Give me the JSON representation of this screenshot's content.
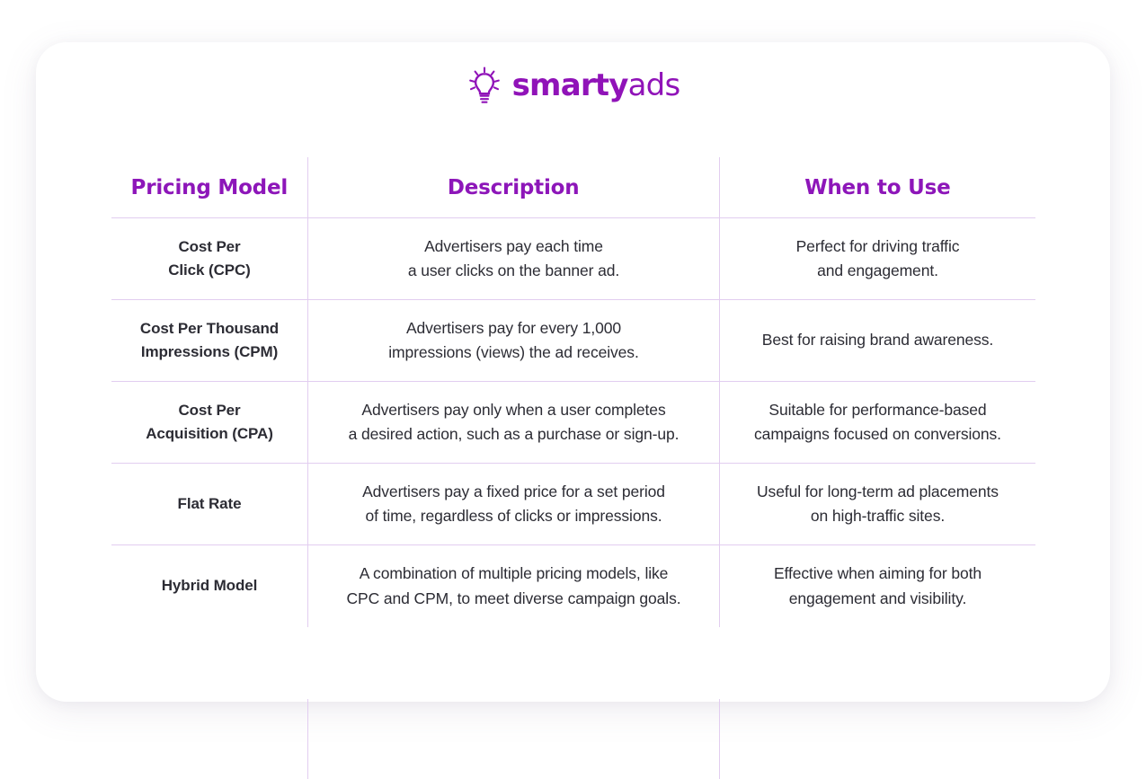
{
  "brand": {
    "name_bold": "smarty",
    "name_light": "ads",
    "logo_icon": "lightbulb-icon",
    "color": "#9013b8"
  },
  "table": {
    "accent_color": "#8d16b9",
    "divider_color": "#e2cdf0",
    "headers": [
      "Pricing Model",
      "Description",
      "When to Use"
    ],
    "rows": [
      {
        "model": [
          "Cost Per",
          "Click (CPC)"
        ],
        "description": [
          "Advertisers pay each time",
          "a user clicks on the banner ad."
        ],
        "when_to_use": [
          "Perfect for driving traffic",
          "and engagement."
        ]
      },
      {
        "model": [
          "Cost Per Thousand",
          "Impressions (CPM)"
        ],
        "description": [
          "Advertisers pay for every 1,000",
          "impressions (views) the ad receives."
        ],
        "when_to_use": [
          "Best for raising brand awareness."
        ]
      },
      {
        "model": [
          "Cost Per",
          "Acquisition (CPA)"
        ],
        "description": [
          "Advertisers pay only when a user completes",
          "a desired action, such as a purchase or sign-up."
        ],
        "when_to_use": [
          "Suitable for performance-based",
          "campaigns focused on conversions."
        ]
      },
      {
        "model": [
          "Flat Rate"
        ],
        "description": [
          "Advertisers pay a fixed price for a set period",
          "of time, regardless of clicks or impressions."
        ],
        "when_to_use": [
          "Useful for long-term ad placements",
          "on high-traffic sites."
        ]
      },
      {
        "model": [
          "Hybrid Model"
        ],
        "description": [
          "A combination of multiple pricing models, like",
          "CPC and CPM, to meet diverse campaign goals."
        ],
        "when_to_use": [
          "Effective when aiming for both",
          "engagement and visibility."
        ]
      }
    ]
  }
}
